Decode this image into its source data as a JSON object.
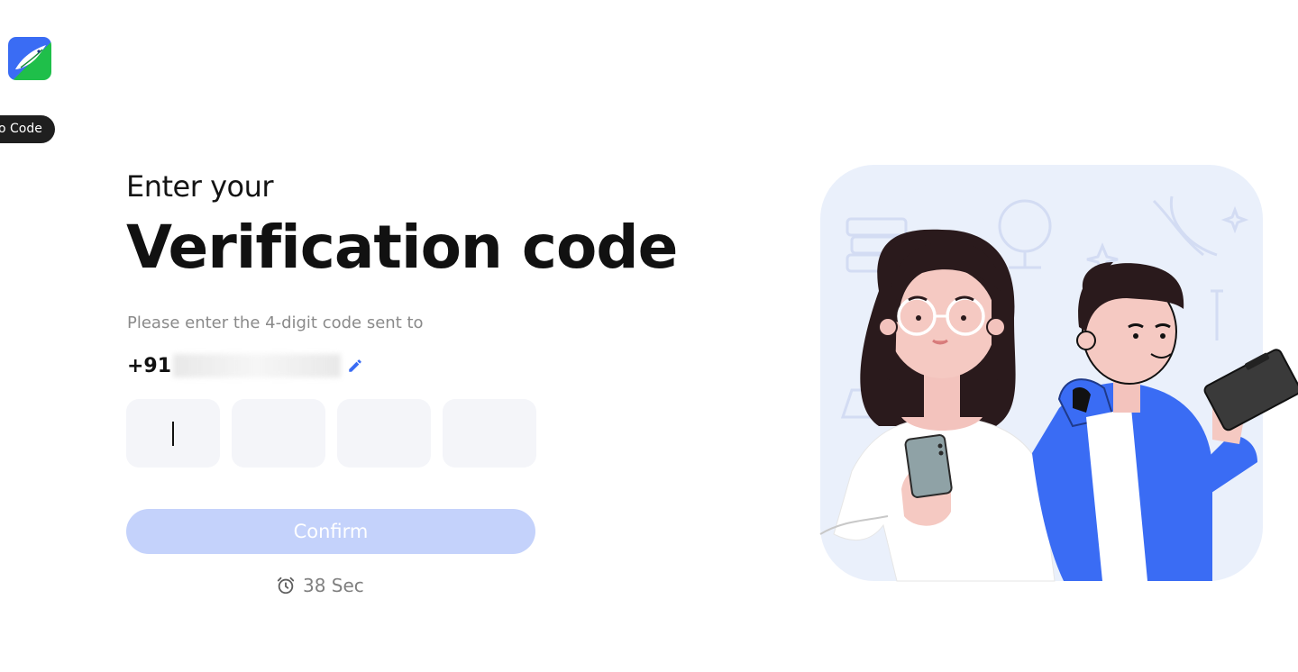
{
  "app": {
    "logo_icon": "bird-logo-icon",
    "brand_colors": {
      "blue": "#3a6cf4",
      "green": "#22c55e"
    }
  },
  "tooltip": {
    "text": "o Code"
  },
  "heading": {
    "line1": "Enter your",
    "line2": "Verification code"
  },
  "instruction": "Please enter the 4-digit code sent to",
  "phone": {
    "prefix": "+91",
    "edit_icon": "pencil-icon"
  },
  "otp": {
    "digits": [
      "",
      "",
      "",
      ""
    ],
    "box_color": "#f4f5f9"
  },
  "confirm": {
    "label": "Confirm",
    "color": "#c4d2fb",
    "disabled": true
  },
  "timer": {
    "icon": "alarm-clock-icon",
    "text": "38 Sec"
  },
  "illustration": {
    "name": "students-with-devices-illustration",
    "background": "#eaf0fb",
    "accent": "#3a6cf4"
  }
}
